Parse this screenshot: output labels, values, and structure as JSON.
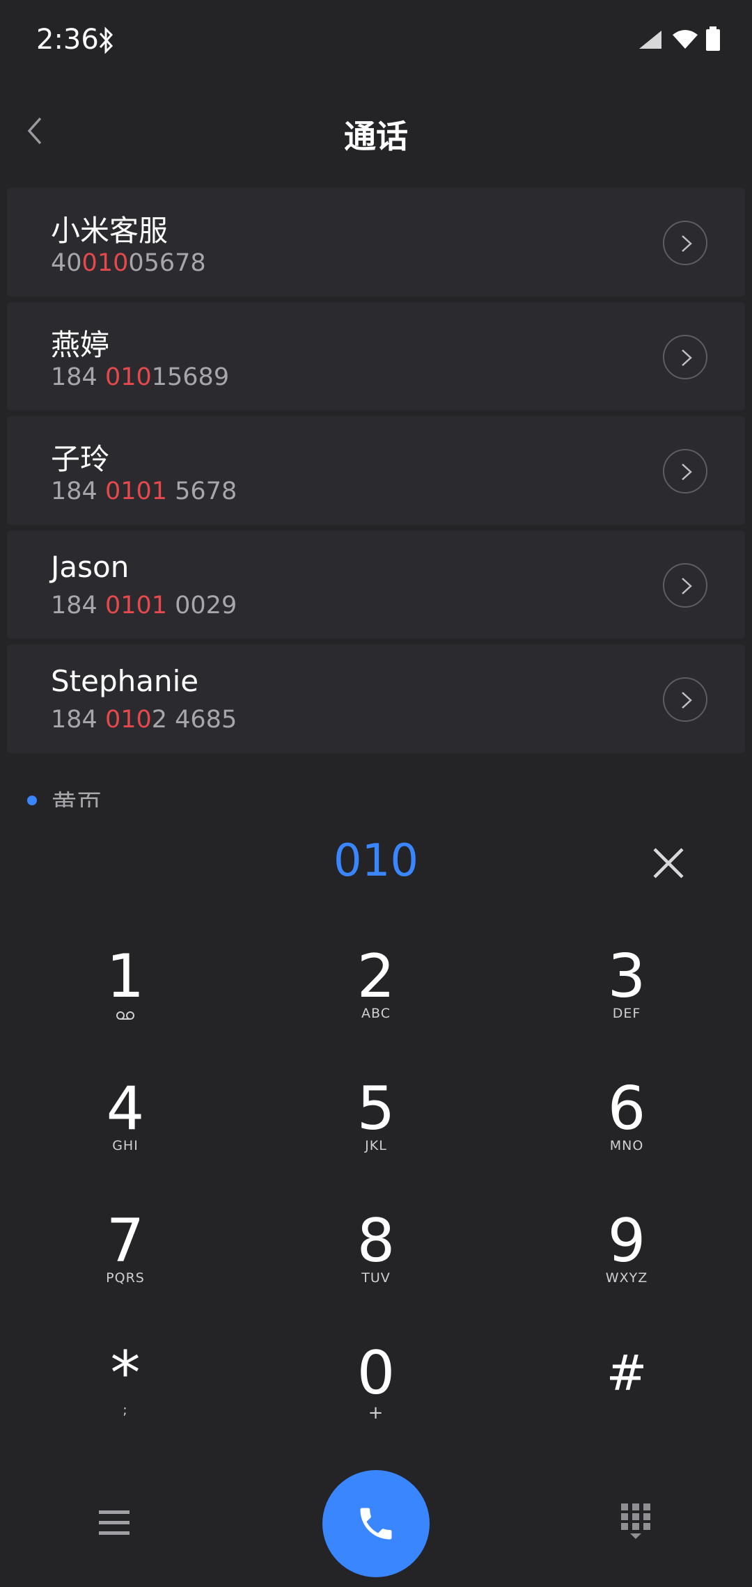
{
  "status": {
    "time": "2:36"
  },
  "header": {
    "title": "通话"
  },
  "contacts": [
    {
      "name": "小米客服",
      "number_pre": "40",
      "number_match": "010",
      "number_post": "05678"
    },
    {
      "name": "燕婷",
      "number_pre": "184 ",
      "number_match": "010",
      "number_post": "15689"
    },
    {
      "name": "子玲",
      "number_pre": "184 ",
      "number_match": "0101",
      "number_post": " 5678"
    },
    {
      "name": "Jason",
      "number_pre": "184 ",
      "number_match": "0101",
      "number_post": " 0029"
    },
    {
      "name": "Stephanie",
      "number_pre": "184 ",
      "number_match": "010",
      "number_post": "2 4685"
    }
  ],
  "section": {
    "label": "黄页"
  },
  "dialer": {
    "input": "010"
  },
  "keypad": [
    {
      "digit": "1",
      "letters": ""
    },
    {
      "digit": "2",
      "letters": "ABC"
    },
    {
      "digit": "3",
      "letters": "DEF"
    },
    {
      "digit": "4",
      "letters": "GHI"
    },
    {
      "digit": "5",
      "letters": "JKL"
    },
    {
      "digit": "6",
      "letters": "MNO"
    },
    {
      "digit": "7",
      "letters": "PQRS"
    },
    {
      "digit": "8",
      "letters": "TUV"
    },
    {
      "digit": "9",
      "letters": "WXYZ"
    },
    {
      "digit": "*",
      "letters": ";"
    },
    {
      "digit": "0",
      "letters": "+"
    },
    {
      "digit": "#",
      "letters": ""
    }
  ],
  "colors": {
    "accent": "#3a86ff",
    "highlight": "#e5484d",
    "background": "#242427"
  },
  "icons": {
    "back": "chevron-left-icon",
    "clear": "close-icon",
    "call": "phone-icon",
    "menu": "menu-icon",
    "keypad_toggle": "dialpad-icon"
  }
}
